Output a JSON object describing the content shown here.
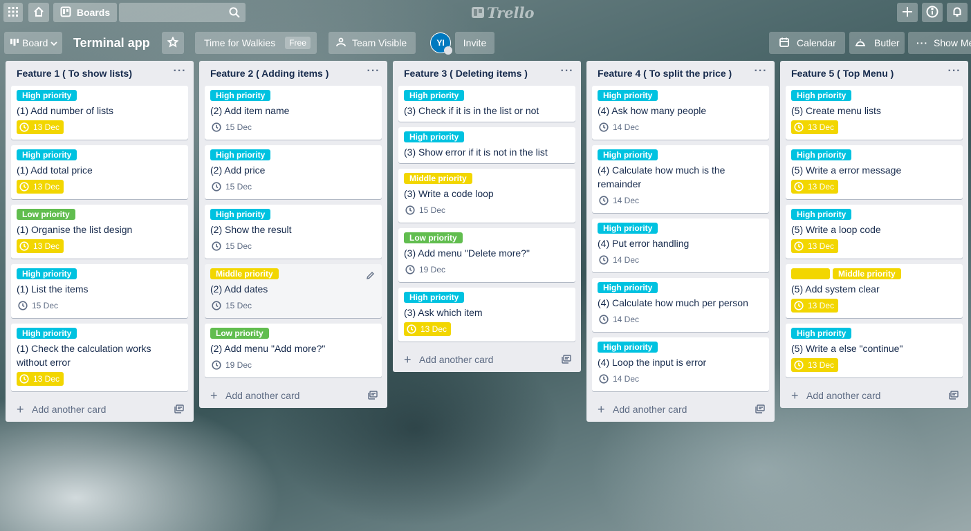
{
  "header": {
    "boards_label": "Boards",
    "search_value": "",
    "logo_text": "Trello"
  },
  "board": {
    "view_label": "Board",
    "title": "Terminal app",
    "team_name": "Time for Walkies",
    "team_plan": "Free",
    "visibility_label": "Team Visible",
    "member_initials": "YI",
    "invite_label": "Invite",
    "calendar_label": "Calendar",
    "butler_label": "Butler",
    "show_menu_label": "Show Me"
  },
  "colors": {
    "label_sky": "#00c2e0",
    "label_green": "#61bd4f",
    "label_yellow": "#f2d600",
    "list_bg": "#ebecf0"
  },
  "lists": [
    {
      "title": "Feature 1 ( To show lists)",
      "add_label": "Add another card",
      "cards": [
        {
          "labels": [
            {
              "text": "High priority",
              "color": "sky"
            }
          ],
          "title": "(1) Add number of lists",
          "due": "13 Dec",
          "due_flag": true
        },
        {
          "labels": [
            {
              "text": "High priority",
              "color": "sky"
            }
          ],
          "title": "(1) Add total price",
          "due": "13 Dec",
          "due_flag": true
        },
        {
          "labels": [
            {
              "text": "Low priority",
              "color": "green"
            }
          ],
          "title": "(1) Organise the list design",
          "due": "13 Dec",
          "due_flag": true
        },
        {
          "labels": [
            {
              "text": "High priority",
              "color": "sky"
            }
          ],
          "title": "(1) List the items",
          "due": "15 Dec",
          "due_flag": false
        },
        {
          "labels": [
            {
              "text": "High priority",
              "color": "sky"
            }
          ],
          "title": "(1) Check the calculation works without error",
          "due": "13 Dec",
          "due_flag": true
        }
      ]
    },
    {
      "title": "Feature 2 ( Adding items )",
      "add_label": "Add another card",
      "cards": [
        {
          "labels": [
            {
              "text": "High priority",
              "color": "sky"
            }
          ],
          "title": "(2) Add item name",
          "due": "15 Dec",
          "due_flag": false
        },
        {
          "labels": [
            {
              "text": "High priority",
              "color": "sky"
            }
          ],
          "title": "(2) Add price",
          "due": "15 Dec",
          "due_flag": false
        },
        {
          "labels": [
            {
              "text": "High priority",
              "color": "sky"
            }
          ],
          "title": "(2) Show the result",
          "due": "15 Dec",
          "due_flag": false
        },
        {
          "labels": [
            {
              "text": "Middle priority",
              "color": "yellow"
            }
          ],
          "title": "(2) Add dates",
          "due": "15 Dec",
          "due_flag": false,
          "hover": true
        },
        {
          "labels": [
            {
              "text": "Low priority",
              "color": "green"
            }
          ],
          "title": "(2) Add menu \"Add more?\"",
          "due": "19 Dec",
          "due_flag": false
        }
      ]
    },
    {
      "title": "Feature 3 ( Deleting items )",
      "add_label": "Add another card",
      "cards": [
        {
          "labels": [
            {
              "text": "High priority",
              "color": "sky"
            }
          ],
          "title": "(3) Check if it is in the list or not",
          "due": "",
          "due_flag": false
        },
        {
          "labels": [
            {
              "text": "High priority",
              "color": "sky"
            }
          ],
          "title": "(3) Show error if it is not in the list",
          "due": "",
          "due_flag": false
        },
        {
          "labels": [
            {
              "text": "Middle priority",
              "color": "yellow"
            }
          ],
          "title": "(3) Write a code loop",
          "due": "15 Dec",
          "due_flag": false
        },
        {
          "labels": [
            {
              "text": "Low priority",
              "color": "green"
            }
          ],
          "title": "(3) Add menu \"Delete more?\"",
          "due": "19 Dec",
          "due_flag": false
        },
        {
          "labels": [
            {
              "text": "High priority",
              "color": "sky"
            }
          ],
          "title": "(3) Ask which item",
          "due": "13 Dec",
          "due_flag": true
        }
      ]
    },
    {
      "title": "Feature 4 ( To split the price )",
      "add_label": "Add another card",
      "cards": [
        {
          "labels": [
            {
              "text": "High priority",
              "color": "sky"
            }
          ],
          "title": "(4) Ask how many people",
          "due": "14 Dec",
          "due_flag": false
        },
        {
          "labels": [
            {
              "text": "High priority",
              "color": "sky"
            }
          ],
          "title": "(4) Calculate how much is the remainder",
          "due": "14 Dec",
          "due_flag": false
        },
        {
          "labels": [
            {
              "text": "High priority",
              "color": "sky"
            }
          ],
          "title": "(4) Put error handling",
          "due": "14 Dec",
          "due_flag": false
        },
        {
          "labels": [
            {
              "text": "High priority",
              "color": "sky"
            }
          ],
          "title": "(4) Calculate how much per person",
          "due": "14 Dec",
          "due_flag": false
        },
        {
          "labels": [
            {
              "text": "High priority",
              "color": "sky"
            }
          ],
          "title": "(4) Loop the input is error",
          "due": "14 Dec",
          "due_flag": false
        }
      ]
    },
    {
      "title": "Feature 5 ( Top Menu )",
      "add_label": "Add another card",
      "cards": [
        {
          "labels": [
            {
              "text": "High priority",
              "color": "sky"
            }
          ],
          "title": "(5) Create menu lists",
          "due": "13 Dec",
          "due_flag": true
        },
        {
          "labels": [
            {
              "text": "High priority",
              "color": "sky"
            }
          ],
          "title": "(5) Write a error message",
          "due": "13 Dec",
          "due_flag": true
        },
        {
          "labels": [
            {
              "text": "High priority",
              "color": "sky"
            }
          ],
          "title": "(5) Write a loop code",
          "due": "13 Dec",
          "due_flag": true
        },
        {
          "labels": [
            {
              "text": "",
              "color": "yellow"
            },
            {
              "text": "Middle priority",
              "color": "yellow"
            }
          ],
          "title": "(5) Add system clear",
          "due": "13 Dec",
          "due_flag": true
        },
        {
          "labels": [
            {
              "text": "High priority",
              "color": "sky"
            }
          ],
          "title": "(5) Write a else \"continue\"",
          "due": "13 Dec",
          "due_flag": true
        }
      ]
    }
  ]
}
